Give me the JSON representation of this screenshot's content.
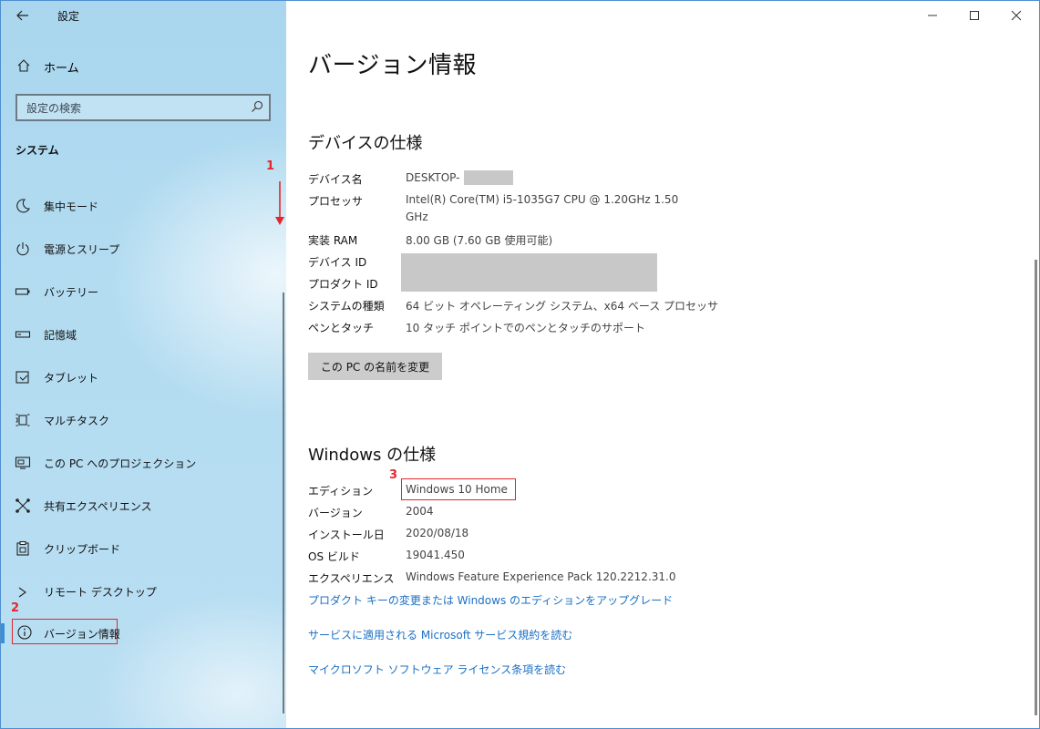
{
  "app": {
    "title": "設定",
    "back_icon": "back-arrow-icon"
  },
  "sidebar": {
    "home_label": "ホーム",
    "search_placeholder": "設定の検索",
    "section_title": "システム",
    "items": [
      {
        "label": "集中モード",
        "icon": "moon-icon"
      },
      {
        "label": "電源とスリープ",
        "icon": "power-icon"
      },
      {
        "label": "バッテリー",
        "icon": "battery-icon"
      },
      {
        "label": "記憶域",
        "icon": "storage-icon"
      },
      {
        "label": "タブレット",
        "icon": "tablet-icon"
      },
      {
        "label": "マルチタスク",
        "icon": "multitask-icon"
      },
      {
        "label": "この PC へのプロジェクション",
        "icon": "projection-icon"
      },
      {
        "label": "共有エクスペリエンス",
        "icon": "shared-icon"
      },
      {
        "label": "クリップボード",
        "icon": "clipboard-icon"
      },
      {
        "label": "リモート デスクトップ",
        "icon": "remote-desktop-icon"
      },
      {
        "label": "バージョン情報",
        "icon": "info-icon",
        "selected": true
      }
    ]
  },
  "annotations": {
    "one": "1",
    "two": "2",
    "three": "3",
    "color": "#e4262a"
  },
  "main": {
    "title": "バージョン情報",
    "device_spec": {
      "heading": "デバイスの仕様",
      "device_name_label": "デバイス名",
      "device_name_value": "DESKTOP-",
      "processor_label": "プロセッサ",
      "processor_value_line1": "Intel(R) Core(TM) i5-1035G7 CPU @ 1.20GHz   1.50",
      "processor_value_line2": "GHz",
      "ram_label": "実装 RAM",
      "ram_value": "8.00 GB (7.60 GB 使用可能)",
      "device_id_label": "デバイス ID",
      "product_id_label": "プロダクト ID",
      "system_type_label": "システムの種類",
      "system_type_value": "64 ビット オペレーティング システム、x64 ベース プロセッサ",
      "pen_touch_label": "ペンとタッチ",
      "pen_touch_value": "10 タッチ ポイントでのペンとタッチのサポート",
      "rename_button": "この PC の名前を変更"
    },
    "windows_spec": {
      "heading": "Windows の仕様",
      "edition_label": "エディション",
      "edition_value": "Windows 10 Home",
      "version_label": "バージョン",
      "version_value": "2004",
      "install_date_label": "インストール日",
      "install_date_value": "2020/08/18",
      "os_build_label": "OS ビルド",
      "os_build_value": "19041.450",
      "experience_label": "エクスペリエンス",
      "experience_value": "Windows Feature Experience Pack 120.2212.31.0"
    },
    "links": {
      "upgrade": "プロダクト キーの変更または Windows のエディションをアップグレード",
      "service_agreement": "サービスに適用される Microsoft サービス規約を読む",
      "license_terms": "マイクロソフト ソフトウェア ライセンス条項を読む"
    }
  },
  "colors": {
    "accent": "#3b8fd6",
    "link": "#1a6fc4",
    "annotation": "#e4262a",
    "sidebar_bg": "#b3dcf1"
  }
}
